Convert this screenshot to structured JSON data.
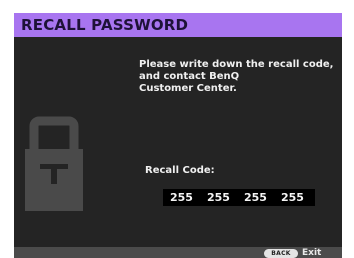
{
  "dialog": {
    "title": "RECALL PASSWORD",
    "message_lines": [
      "Please write down the recall code,",
      "and contact BenQ",
      "Customer Center."
    ],
    "recall_label": "Recall Code:",
    "recall_code": [
      "255",
      "255",
      "255",
      "255"
    ]
  },
  "footer": {
    "back_key": "BACK",
    "exit_label": "Exit"
  },
  "icons": {
    "lock": "lock-icon"
  },
  "colors": {
    "title_bar": "#a875f0",
    "dialog_background": "#242424",
    "footer_background": "#4b4b4b",
    "code_background": "#000000",
    "lock_icon": "#4a4a4a"
  }
}
